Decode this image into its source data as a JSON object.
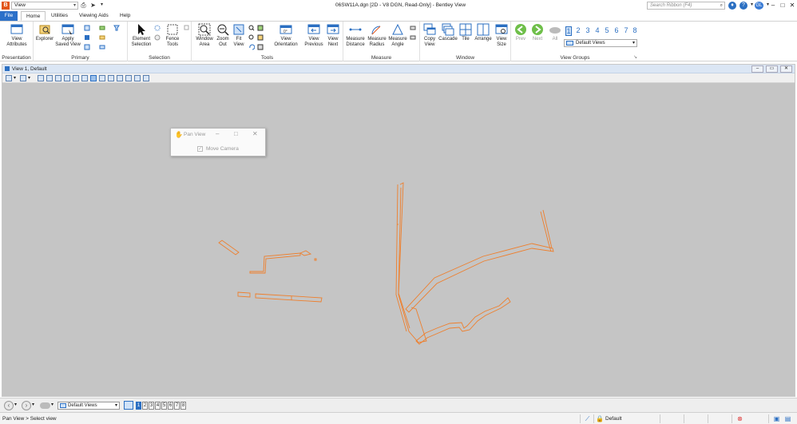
{
  "titlebar": {
    "workflow": "View",
    "document_title": "06SW11A.dgn [2D - V8 DGN, Read-Only] - Bentley View",
    "search_placeholder": "Search Ribbon (F4)",
    "user_initials": "GL"
  },
  "tabs": [
    "File",
    "Home",
    "Utilities",
    "Viewing Aids",
    "Help"
  ],
  "ribbon": {
    "presentation": {
      "label": "Presentation",
      "buttons": [
        "View\nAttributes"
      ]
    },
    "primary": {
      "label": "Primary",
      "buttons": [
        "Explorer",
        "Apply\nSaved View"
      ]
    },
    "selection": {
      "label": "Selection",
      "buttons": [
        "Element\nSelection",
        "Fence\nTools"
      ]
    },
    "tools": {
      "label": "Tools",
      "buttons": [
        "Window\nArea",
        "Zoom\nOut",
        "Fit\nView",
        "View\nOrientation",
        "View\nPrevious",
        "View\nNext"
      ]
    },
    "measure": {
      "label": "Measure",
      "buttons": [
        "Measure\nDistance",
        "Measure\nRadius",
        "Measure\nAngle"
      ]
    },
    "window": {
      "label": "Window",
      "buttons": [
        "Copy\nView",
        "Cascade",
        "Tile",
        "Arrange",
        "View\nSize"
      ]
    },
    "view_groups": {
      "label": "View Groups",
      "buttons": [
        "Prev",
        "Next",
        "All"
      ],
      "numbers": [
        "1",
        "2",
        "3",
        "4",
        "5",
        "6",
        "7",
        "8"
      ],
      "selected": "Default Views"
    }
  },
  "view_window": {
    "title": "View 1, Default"
  },
  "pan_view": {
    "title": "Pan View",
    "option": "Move Camera"
  },
  "bottom_bar": {
    "selected_group": "Default Views",
    "view_numbers": [
      "1",
      "2",
      "3",
      "4",
      "5",
      "6",
      "7",
      "8"
    ],
    "active_view": "1"
  },
  "status": {
    "prompt": "Pan View > Select view",
    "active_model": "Default"
  },
  "colors": {
    "accent": "#2b70c9",
    "geometry": "#ee7f2d",
    "canvas": "#c5c5c5"
  }
}
